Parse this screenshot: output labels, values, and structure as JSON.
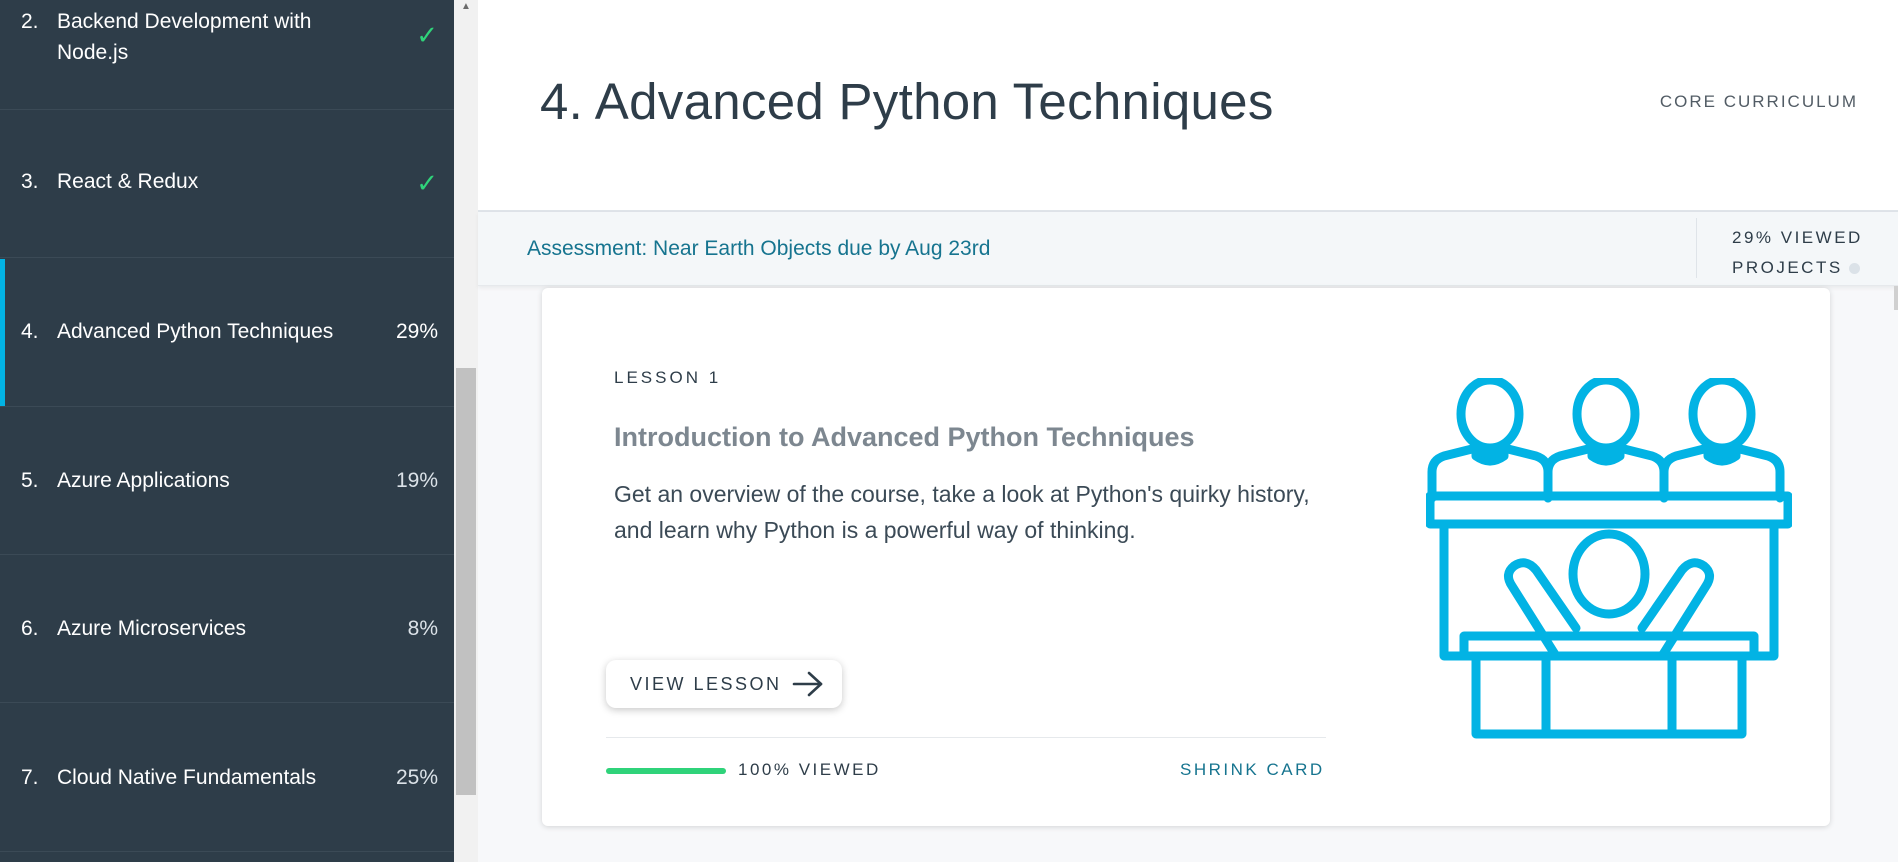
{
  "sidebar": {
    "items": [
      {
        "num": "2.",
        "title": "Backend Development with Node.js",
        "status": "✓",
        "kind": "check"
      },
      {
        "num": "3.",
        "title": "React & Redux",
        "status": "✓",
        "kind": "check"
      },
      {
        "num": "4.",
        "title": "Advanced Python Techniques",
        "status": "29%",
        "kind": "active"
      },
      {
        "num": "5.",
        "title": "Azure Applications",
        "status": "19%",
        "kind": "pct"
      },
      {
        "num": "6.",
        "title": "Azure Microservices",
        "status": "8%",
        "kind": "pct"
      },
      {
        "num": "7.",
        "title": "Cloud Native Fundamentals",
        "status": "25%",
        "kind": "pct"
      }
    ]
  },
  "header": {
    "title": "4. Advanced Python Techniques",
    "curriculum_label": "CORE CURRICULUM"
  },
  "assessment": {
    "text": "Assessment: Near Earth Objects due by Aug 23rd",
    "viewed": "29% VIEWED",
    "projects": "PROJECTS"
  },
  "lesson": {
    "label": "LESSON 1",
    "title": "Introduction to Advanced Python Techniques",
    "description": "Get an overview of the course, take a look at Python's quirky history, and learn why Python is a powerful way of thinking.",
    "button_label": "VIEW LESSON",
    "progress": 1.0,
    "viewed_label": "100% VIEWED",
    "shrink_label": "SHRINK CARD",
    "illustration_icon": "audience-presenter-icon"
  },
  "colors": {
    "sidebar_bg": "#2e3d49",
    "accent": "#02b3e4",
    "check": "#2fd37a",
    "link": "#16748f",
    "progress": "#2fd37a"
  }
}
